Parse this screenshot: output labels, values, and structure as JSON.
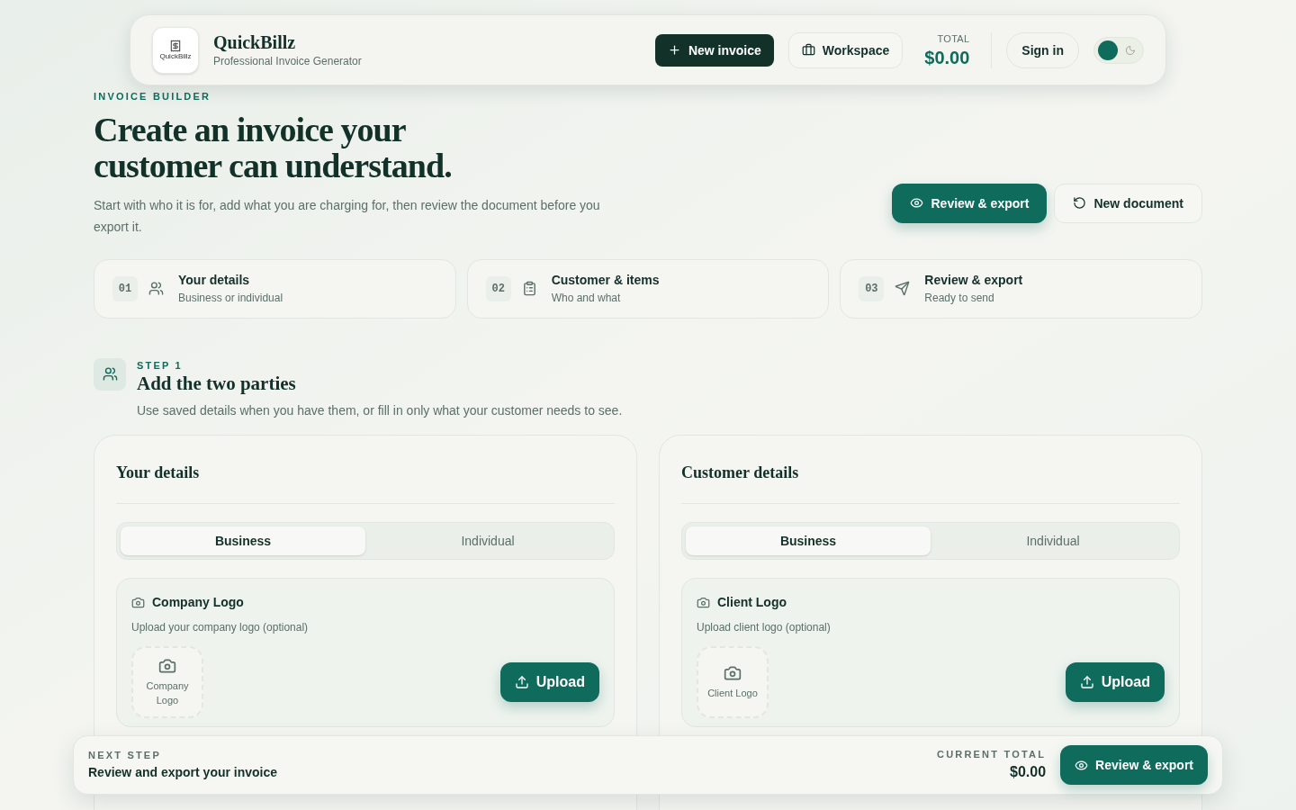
{
  "header": {
    "logo_text": "QuickBillz",
    "brand": "QuickBillz",
    "tagline": "Professional Invoice Generator",
    "new_invoice": "New invoice",
    "workspace": "Workspace",
    "total_label": "TOTAL",
    "total": "$0.00",
    "sign_in": "Sign in",
    "dark_mode": false
  },
  "hero": {
    "eyebrow": "INVOICE BUILDER",
    "title_line1": "Create an invoice your",
    "title_line2": "customer can understand.",
    "description": "Start with who it is for, add what you are charging for, then review the document before you export it.",
    "review_button": "Review & export",
    "new_document_button": "New document"
  },
  "steps": [
    {
      "number": "01",
      "kind": "people",
      "title": "Your details",
      "subtitle": "Business or individual"
    },
    {
      "number": "02",
      "kind": "clipboard",
      "title": "Customer & items",
      "subtitle": "Who and what"
    },
    {
      "number": "03",
      "kind": "send",
      "title": "Review & export",
      "subtitle": "Ready to send"
    }
  ],
  "section": {
    "eyebrow": "STEP 1",
    "title": "Add the two parties",
    "description": "Use saved details when you have them, or fill in only what your customer needs to see."
  },
  "panels": [
    {
      "title": "Your details",
      "tabs": [
        {
          "label": "Business",
          "selected": true
        },
        {
          "label": "Individual",
          "selected": false
        }
      ],
      "logo_title": "Company Logo",
      "logo_hint": "Upload your company logo (optional)",
      "placeholder_label": "Company Logo",
      "upload": "Upload"
    },
    {
      "title": "Customer details",
      "tabs": [
        {
          "label": "Business",
          "selected": true
        },
        {
          "label": "Individual",
          "selected": false
        }
      ],
      "logo_title": "Client Logo",
      "logo_hint": "Upload client logo (optional)",
      "placeholder_label": "Client Logo",
      "upload": "Upload"
    }
  ],
  "bottom_bar": {
    "eyebrow": "NEXT STEP",
    "text": "Review and export your invoice",
    "total_label": "CURRENT TOTAL",
    "total": "$0.00",
    "button": "Review & export"
  }
}
